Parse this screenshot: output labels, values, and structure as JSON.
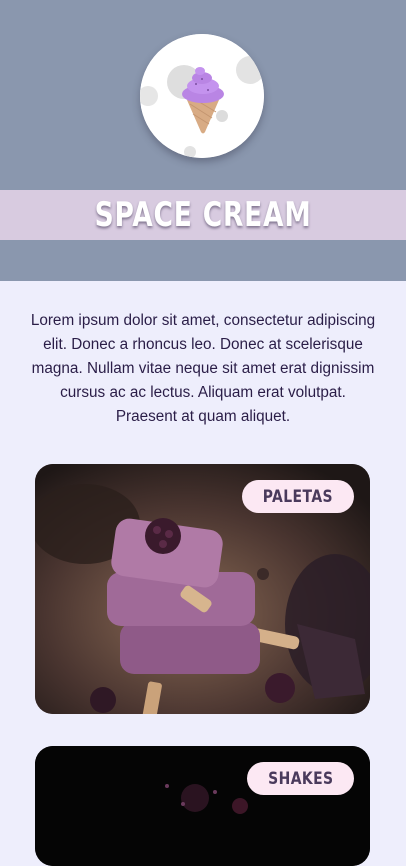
{
  "header": {
    "brand_name": "SPACE CREAM",
    "logo_icon": "ice-cream-moon-icon"
  },
  "intro": {
    "text": "Lorem ipsum dolor sit amet, consectetur adipiscing elit. Donec a rhoncus leo. Donec at scelerisque magna. Nullam vitae neque sit amet erat dignissim cursus ac ac lectus. Aliquam erat volutpat. Praesent at quam aliquet."
  },
  "categories": [
    {
      "label": "PALETAS",
      "image": "stacked-berry-popsicles-photo"
    },
    {
      "label": "SHAKES",
      "image": "dark-berry-shake-photo"
    }
  ],
  "colors": {
    "hero_bg": "#8a97ae",
    "banner_bg": "#d8cbe0",
    "page_bg": "#eeeefc",
    "text": "#2a1d47",
    "pill_bg": "#fce8f3"
  }
}
